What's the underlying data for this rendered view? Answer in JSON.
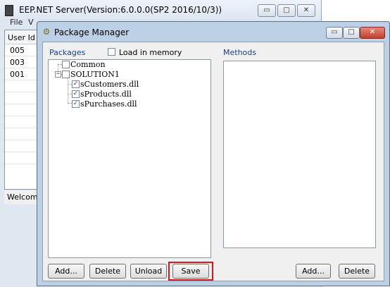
{
  "background_window": {
    "title": "EEP.NET Server(Version:6.0.0.0(SP2 2016/10/3))",
    "controls": {
      "minimize": "▭",
      "maximize": "□",
      "close": "✕"
    },
    "menu": [
      "File",
      "V"
    ],
    "grid": {
      "header": "User Id",
      "rows": [
        "005",
        "003",
        "001"
      ]
    },
    "status": "Welcome"
  },
  "dialog": {
    "title": "Package Manager",
    "controls": {
      "minimize": "▭",
      "maximize": "□",
      "close": "✕"
    },
    "packages_label": "Packages",
    "load_in_memory_label": "Load in memory",
    "load_in_memory_checked": false,
    "methods_label": "Methods",
    "tree": {
      "common": {
        "label": "Common",
        "checked": false
      },
      "solution": {
        "label": "SOLUTION1",
        "checked": false,
        "expanded": true,
        "children": [
          {
            "label": "sCustomers.dll",
            "checked": true
          },
          {
            "label": "sProducts.dll",
            "checked": true
          },
          {
            "label": "sPurchases.dll",
            "checked": true
          }
        ]
      }
    },
    "buttons": {
      "add": "Add...",
      "delete": "Delete",
      "unload": "Unload",
      "save": "Save",
      "methods_add": "Add...",
      "methods_delete": "Delete"
    },
    "highlight_color": "#e0161e",
    "check_mark": "✓"
  }
}
